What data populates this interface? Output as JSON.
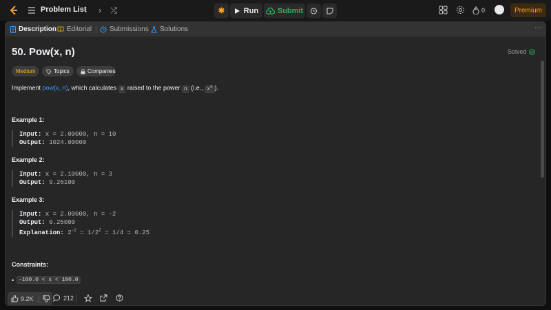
{
  "topbar": {
    "problem_list_label": "Problem List",
    "run_label": "Run",
    "submit_label": "Submit",
    "streak_count": "0",
    "premium_label": "Premium"
  },
  "tabs": [
    {
      "label": "Description"
    },
    {
      "label": "Editorial"
    },
    {
      "label": "Submissions"
    },
    {
      "label": "Solutions"
    }
  ],
  "problem": {
    "title": "50. Pow(x, n)",
    "status": "Solved",
    "difficulty": "Medium",
    "topics_label": "Topics",
    "companies_label": "Companies",
    "desc_prefix": "Implement ",
    "desc_link": "pow(x, n)",
    "desc_mid": ", which calculates ",
    "desc_code_x": "x",
    "desc_mid2": " raised to the power ",
    "desc_code_n": "n",
    "desc_mid3": " (i.e., ",
    "desc_code_xn_base": "x",
    "desc_code_xn_exp": "n",
    "desc_suffix": ")."
  },
  "examples": [
    {
      "heading": "Example 1:",
      "input_label": "Input:",
      "input": "x = 2.00000, n = 10",
      "output_label": "Output:",
      "output": "1024.00000"
    },
    {
      "heading": "Example 2:",
      "input_label": "Input:",
      "input": "x = 2.10000, n = 3",
      "output_label": "Output:",
      "output": "9.26100"
    },
    {
      "heading": "Example 3:",
      "input_label": "Input:",
      "input": "x = 2.00000, n = -2",
      "output_label": "Output:",
      "output": "0.25000",
      "explanation_label": "Explanation:",
      "explanation_base": "2",
      "explanation_exp": "-2",
      "explanation_mid": " = 1/2",
      "explanation_exp2": "2",
      "explanation_end": " = 1/4 = 0.25"
    }
  ],
  "constraints": {
    "heading": "Constraints:",
    "item1": "-100.0 < x < 100.0"
  },
  "footer": {
    "likes": "9.2K",
    "comments": "212"
  },
  "colors": {
    "accent": "#ffa116",
    "submit_green": "#2cbb5d",
    "link_blue": "#3b9cff",
    "medium_yellow": "#ffb800"
  }
}
